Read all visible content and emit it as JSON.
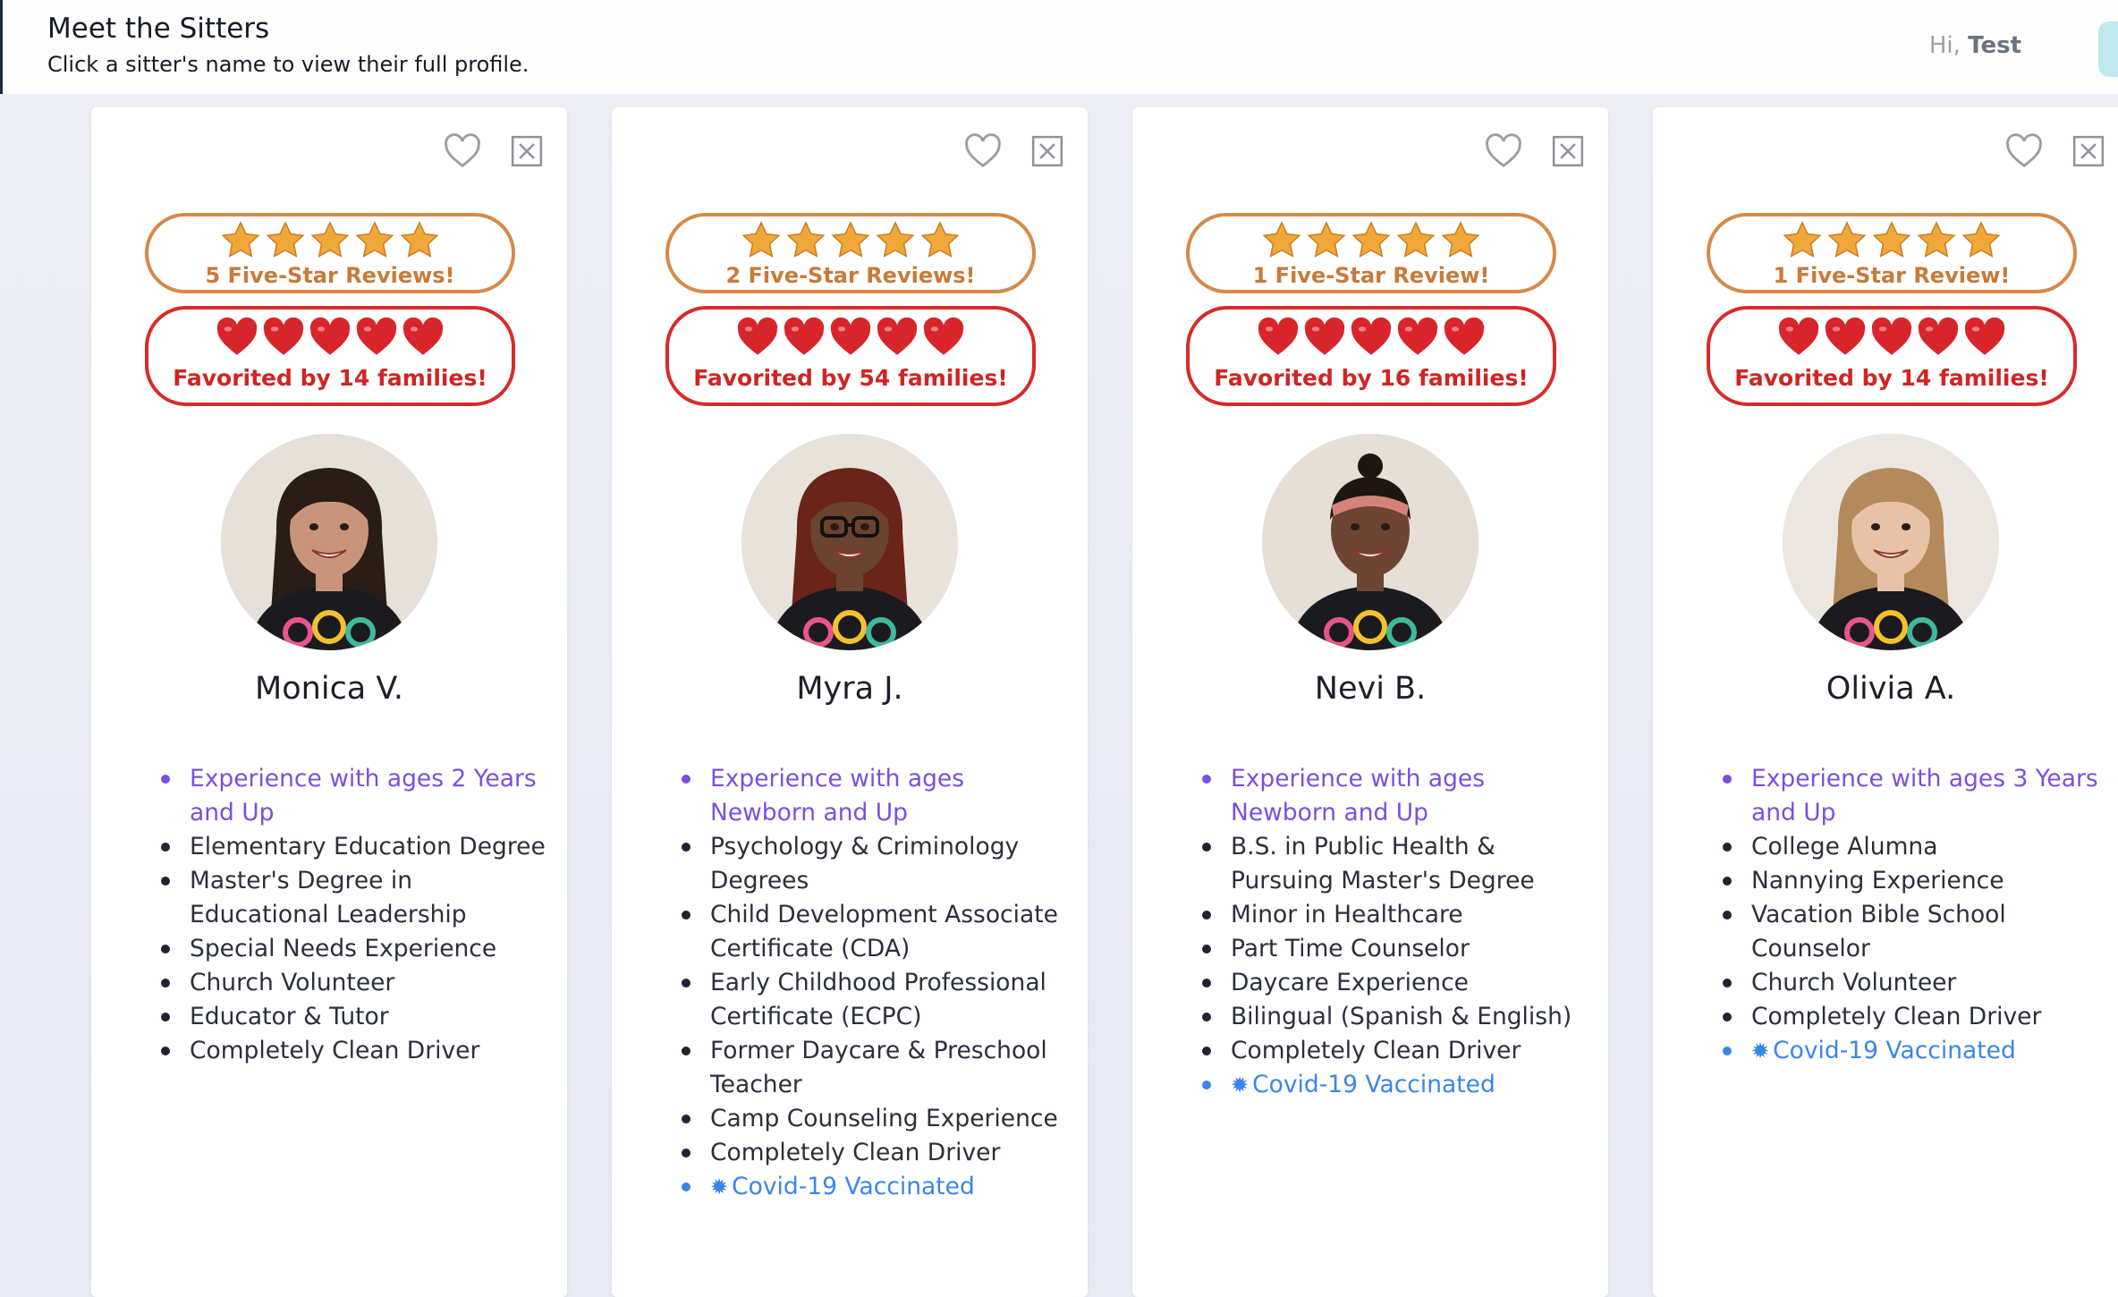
{
  "header": {
    "title": "Meet the Sitters",
    "subtitle": "Click a sitter's name to view their full profile.",
    "greeting_prefix": "Hi,",
    "user_name": "Test"
  },
  "colors": {
    "review_border": "#d48a4a",
    "favorite_border": "#d82a2a",
    "experience_text": "#7b4fe0",
    "vaccinated_text": "#3a86e8"
  },
  "icons": {
    "favorite": "heart-outline-icon",
    "dismiss": "close-box-icon",
    "star": "star-icon",
    "heart": "red-heart-icon",
    "vaccinated": "virus-icon"
  },
  "sitters": [
    {
      "name": "Monica V.",
      "reviews_label": "5 Five-Star Reviews!",
      "favorites_label": "Favorited by 14 families!",
      "stars": 5,
      "hearts": 5,
      "features": [
        {
          "text": "Experience with ages 2 Years and Up",
          "kind": "experience"
        },
        {
          "text": "Elementary Education Degree",
          "kind": "normal"
        },
        {
          "text": "Master's Degree in Educational Leadership",
          "kind": "normal"
        },
        {
          "text": "Special Needs Experience",
          "kind": "normal"
        },
        {
          "text": "Church Volunteer",
          "kind": "normal"
        },
        {
          "text": "Educator & Tutor",
          "kind": "normal"
        },
        {
          "text": "Completely Clean Driver",
          "kind": "normal"
        }
      ]
    },
    {
      "name": "Myra J.",
      "reviews_label": "2 Five-Star Reviews!",
      "favorites_label": "Favorited by 54 families!",
      "stars": 5,
      "hearts": 5,
      "features": [
        {
          "text": "Experience with ages Newborn and Up",
          "kind": "experience"
        },
        {
          "text": "Psychology & Criminology Degrees",
          "kind": "normal"
        },
        {
          "text": "Child Development Associate Certificate (CDA)",
          "kind": "normal"
        },
        {
          "text": "Early Childhood Professional Certificate (ECPC)",
          "kind": "normal"
        },
        {
          "text": "Former Daycare & Preschool Teacher",
          "kind": "normal"
        },
        {
          "text": "Camp Counseling Experience",
          "kind": "normal"
        },
        {
          "text": "Completely Clean Driver",
          "kind": "normal"
        },
        {
          "text": "Covid-19 Vaccinated",
          "kind": "vaccinated"
        }
      ]
    },
    {
      "name": "Nevi B.",
      "reviews_label": "1 Five-Star Review!",
      "favorites_label": "Favorited by 16 families!",
      "stars": 5,
      "hearts": 5,
      "features": [
        {
          "text": "Experience with ages Newborn and Up",
          "kind": "experience"
        },
        {
          "text": "B.S. in Public Health & Pursuing Master's Degree",
          "kind": "normal"
        },
        {
          "text": "Minor in Healthcare",
          "kind": "normal"
        },
        {
          "text": "Part Time Counselor",
          "kind": "normal"
        },
        {
          "text": "Daycare Experience",
          "kind": "normal"
        },
        {
          "text": "Bilingual (Spanish & English)",
          "kind": "normal"
        },
        {
          "text": "Completely Clean Driver",
          "kind": "normal"
        },
        {
          "text": "Covid-19 Vaccinated",
          "kind": "vaccinated"
        }
      ]
    },
    {
      "name": "Olivia A.",
      "reviews_label": "1 Five-Star Review!",
      "favorites_label": "Favorited by 14 families!",
      "stars": 5,
      "hearts": 5,
      "features": [
        {
          "text": "Experience with ages 3 Years and Up",
          "kind": "experience"
        },
        {
          "text": "College Alumna",
          "kind": "normal"
        },
        {
          "text": "Nannying Experience",
          "kind": "normal"
        },
        {
          "text": "Vacation Bible School Counselor",
          "kind": "normal"
        },
        {
          "text": "Church Volunteer",
          "kind": "normal"
        },
        {
          "text": "Completely Clean Driver",
          "kind": "normal"
        },
        {
          "text": "Covid-19 Vaccinated",
          "kind": "vaccinated"
        }
      ]
    }
  ]
}
